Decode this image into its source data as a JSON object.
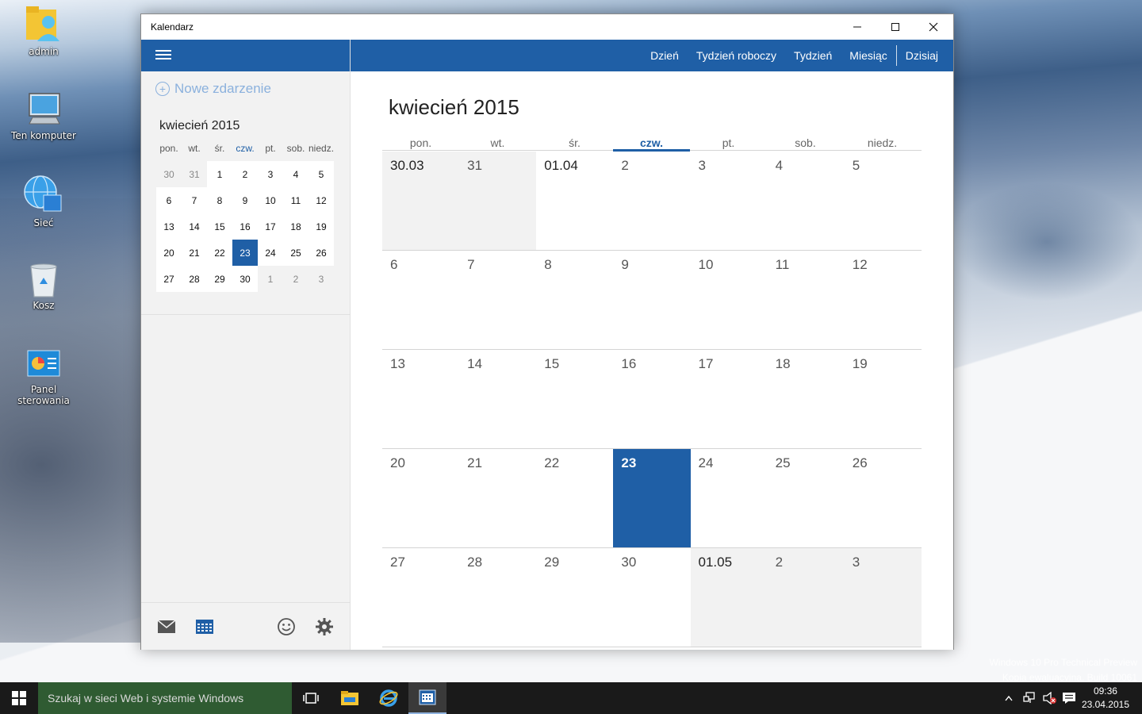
{
  "desktop": {
    "icons": [
      {
        "label": "admin"
      },
      {
        "label": "Ten komputer"
      },
      {
        "label": "Sieć"
      },
      {
        "label": "Kosz"
      },
      {
        "label": "Panel sterowania"
      }
    ],
    "watermark": [
      "Windows 10 Pro Technical Preview",
      "Kopia ewaluacyjna. Build 10061"
    ]
  },
  "window": {
    "title": "Kalendarz",
    "controls": [
      "minimize-icon",
      "maximize-icon",
      "close-icon"
    ]
  },
  "sidebar": {
    "new_event_label": "Nowe zdarzenie",
    "mini_calendar": {
      "month_label": "kwiecień 2015",
      "weekdays": [
        "pon.",
        "wt.",
        "śr.",
        "czw.",
        "pt.",
        "sob.",
        "niedz."
      ],
      "today_weekday": "czw.",
      "days": [
        {
          "d": "30",
          "out": true
        },
        {
          "d": "31",
          "out": true
        },
        {
          "d": "1"
        },
        {
          "d": "2"
        },
        {
          "d": "3"
        },
        {
          "d": "4"
        },
        {
          "d": "5"
        },
        {
          "d": "6"
        },
        {
          "d": "7"
        },
        {
          "d": "8"
        },
        {
          "d": "9"
        },
        {
          "d": "10"
        },
        {
          "d": "11"
        },
        {
          "d": "12"
        },
        {
          "d": "13"
        },
        {
          "d": "14"
        },
        {
          "d": "15"
        },
        {
          "d": "16"
        },
        {
          "d": "17"
        },
        {
          "d": "18"
        },
        {
          "d": "19"
        },
        {
          "d": "20"
        },
        {
          "d": "21"
        },
        {
          "d": "22"
        },
        {
          "d": "23",
          "selected": true
        },
        {
          "d": "24"
        },
        {
          "d": "25"
        },
        {
          "d": "26"
        },
        {
          "d": "27"
        },
        {
          "d": "28"
        },
        {
          "d": "29"
        },
        {
          "d": "30"
        },
        {
          "d": "1",
          "out": true
        },
        {
          "d": "2",
          "out": true
        },
        {
          "d": "3",
          "out": true
        }
      ]
    },
    "bottom_icons": [
      "mail-icon",
      "calendar-icon",
      "feedback-smiley-icon",
      "settings-gear-icon"
    ]
  },
  "toolbar": {
    "views": [
      "Dzień",
      "Tydzień roboczy",
      "Tydzień",
      "Miesiąc"
    ],
    "today_label": "Dzisiaj"
  },
  "month_view": {
    "title": "kwiecień 2015",
    "weekdays": [
      "pon.",
      "wt.",
      "śr.",
      "czw.",
      "pt.",
      "sob.",
      "niedz."
    ],
    "today_weekday": "czw.",
    "days": [
      {
        "d": "30.03",
        "out": true,
        "first": true
      },
      {
        "d": "31",
        "out": true
      },
      {
        "d": "01.04",
        "first": true
      },
      {
        "d": "2"
      },
      {
        "d": "3"
      },
      {
        "d": "4"
      },
      {
        "d": "5"
      },
      {
        "d": "6"
      },
      {
        "d": "7"
      },
      {
        "d": "8"
      },
      {
        "d": "9"
      },
      {
        "d": "10"
      },
      {
        "d": "11"
      },
      {
        "d": "12"
      },
      {
        "d": "13"
      },
      {
        "d": "14"
      },
      {
        "d": "15"
      },
      {
        "d": "16"
      },
      {
        "d": "17"
      },
      {
        "d": "18"
      },
      {
        "d": "19"
      },
      {
        "d": "20"
      },
      {
        "d": "21"
      },
      {
        "d": "22"
      },
      {
        "d": "23",
        "selected": true
      },
      {
        "d": "24"
      },
      {
        "d": "25"
      },
      {
        "d": "26"
      },
      {
        "d": "27"
      },
      {
        "d": "28"
      },
      {
        "d": "29"
      },
      {
        "d": "30"
      },
      {
        "d": "01.05",
        "out": true,
        "first": true
      },
      {
        "d": "2",
        "out": true
      },
      {
        "d": "3",
        "out": true
      }
    ]
  },
  "taskbar": {
    "search_placeholder": "Szukaj w sieci Web i systemie Windows",
    "time": "09:36",
    "date": "23.04.2015"
  },
  "colors": {
    "accent": "#1f5fa6",
    "sidebar_bg": "#f2f2f2",
    "out_of_month_bg": "#f2f2f2",
    "taskbar_bg": "#1a1a1a",
    "search_bg": "#2f5b32"
  }
}
